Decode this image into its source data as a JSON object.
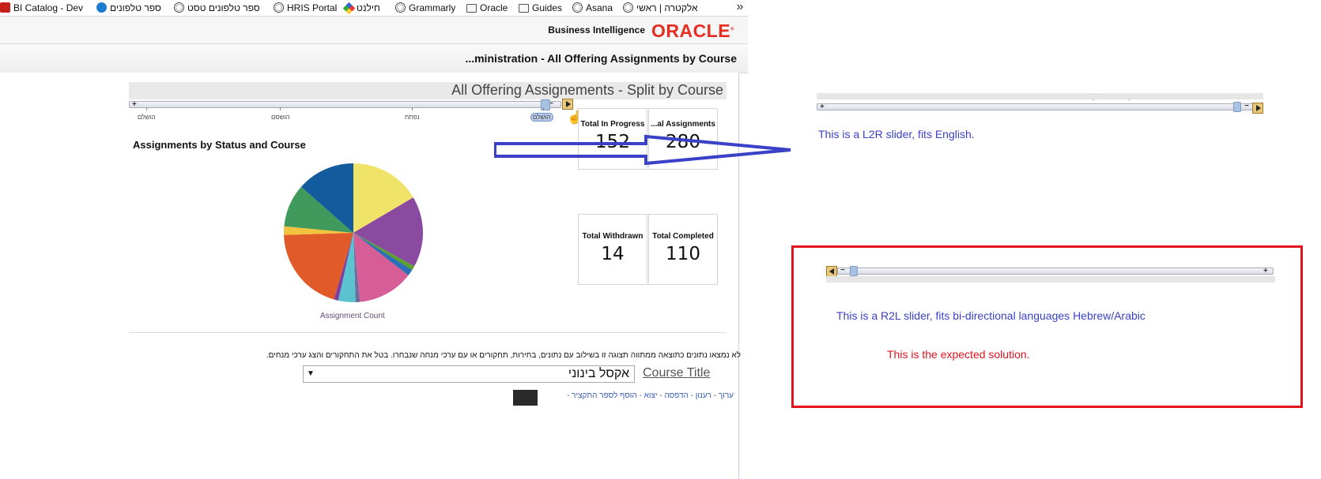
{
  "bookmarks": {
    "items": [
      {
        "label": "BI Catalog - Dev",
        "icon": "oracle-icon"
      },
      {
        "label": "ספר טלפונים",
        "icon": "phone-book-icon"
      },
      {
        "label": "ספר טלפונים טסט",
        "icon": "globe-icon"
      },
      {
        "label": "HRIS Portal",
        "icon": "globe-icon"
      },
      {
        "label": "חילנט",
        "icon": "colorful-logo-icon"
      },
      {
        "label": "Grammarly",
        "icon": "globe-icon"
      },
      {
        "label": "Oracle",
        "icon": "folder-icon"
      },
      {
        "label": "Guides",
        "icon": "folder-icon"
      },
      {
        "label": "Asana",
        "icon": "globe-icon"
      },
      {
        "label": "אלקטרה | ראשי",
        "icon": "globe-icon"
      }
    ],
    "more": "»"
  },
  "header": {
    "bi_label": "Business Intelligence",
    "logo_text": "ORACLE",
    "logo_mark": "®"
  },
  "page": {
    "title": "...ministration - All Offering Assignments by Course"
  },
  "report": {
    "title": "All Offering Assignements - Split by Course",
    "slider_ticks": [
      "הושלם",
      "הושסם",
      "נפתח",
      "הושלם"
    ],
    "kpis": [
      {
        "label": "...al Assignments",
        "value": "280"
      },
      {
        "label": "Total In Progress",
        "value": "152"
      },
      {
        "label": "Total Completed",
        "value": "110"
      },
      {
        "label": "Total Withdrawn",
        "value": "14"
      }
    ],
    "pie_title": "Assignments by Status and Course",
    "pie_caption": "Assignment Count",
    "no_data_text": "לא נמצאו נתונים כתוצאה ממתווה תצוגה זו בשילוב עם נתונים, בחירות, תחקורים או עם ערכי מנחה שנבחרו. בטל את התחקורים והצג ערכי מנחים.",
    "no_data_link": "בטל את התחקורים והצג ערכי מנחים.",
    "course_prompt_label": "Course Title",
    "course_prompt_value": "אקסל בינוני",
    "footer_links": "ערוך - רענון - הדפסה - יצוא - הוסף לספר התקציר -"
  },
  "chart_data": {
    "type": "pie",
    "title": "Assignments by Status and Course",
    "xlabel": "Assignment Count",
    "slices": [
      {
        "color": "#f0e36a",
        "value": 16.5
      },
      {
        "color": "#8a4aa0",
        "value": 16.5
      },
      {
        "color": "#5aa02c",
        "value": 1
      },
      {
        "color": "#2d6fb7",
        "value": 1.5
      },
      {
        "color": "#d75d96",
        "value": 13
      },
      {
        "color": "#6e6e9e",
        "value": 1
      },
      {
        "color": "#5bc3cf",
        "value": 4
      },
      {
        "color": "#7b3fa0",
        "value": 1
      },
      {
        "color": "#e05a2a",
        "value": 20
      },
      {
        "color": "#f2c33e",
        "value": 2
      },
      {
        "color": "#3f9a5b",
        "value": 10
      },
      {
        "color": "#125c9e",
        "value": 13.5
      }
    ]
  },
  "annotations": {
    "l2r_caption": "This is a L2R slider, fits English.",
    "r2l_caption": "This is a R2L slider, fits bi-directional languages Hebrew/Arabic",
    "expected_caption": "This is the expected solution.",
    "clipped_title": "All Offering Assignements"
  },
  "colors": {
    "oracle_red": "#e52d21",
    "annotation_blue": "#3a41c7",
    "annotation_red": "#e3141e",
    "link_blue": "#3a5bb5"
  }
}
